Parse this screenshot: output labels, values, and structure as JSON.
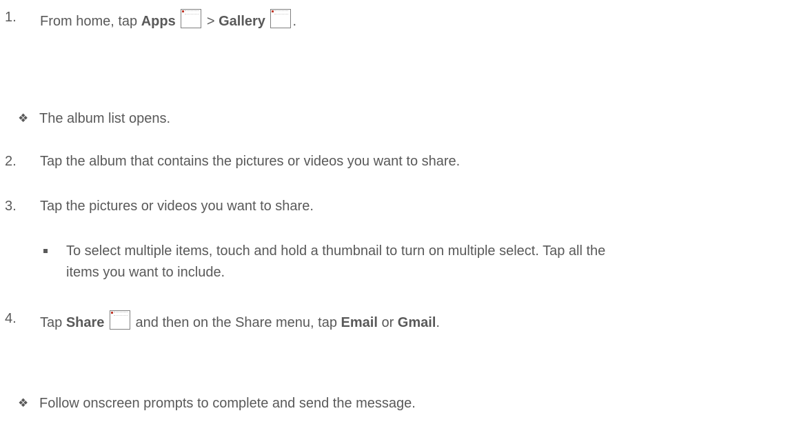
{
  "steps": [
    {
      "number": "1.",
      "pre": "From home, tap ",
      "bold1": "Apps",
      "mid": " > ",
      "bold2": "Gallery",
      "post": "."
    },
    {
      "number": "2.",
      "text": "Tap the album that contains the pictures or videos you want to share."
    },
    {
      "number": "3.",
      "text": "Tap the pictures or videos you want to share."
    },
    {
      "number": "4.",
      "pre": "Tap ",
      "bold1": "Share",
      "mid": " and then on the Share menu, tap ",
      "bold2": "Email",
      "mid2": " or ",
      "bold3": "Gmail",
      "post": "."
    }
  ],
  "notes": {
    "album_opens": "The album list opens.",
    "multi_select_line1": "To select multiple items, touch and hold a thumbnail to turn on multiple select. Tap all the",
    "multi_select_line2": "items you want to include.",
    "follow_prompts": "Follow onscreen prompts to complete and send the message."
  },
  "symbols": {
    "diamond_bullet": "❖"
  },
  "icons": {
    "apps": "apps-icon",
    "gallery": "gallery-icon",
    "share": "share-icon"
  },
  "colors": {
    "text": "#595959"
  }
}
